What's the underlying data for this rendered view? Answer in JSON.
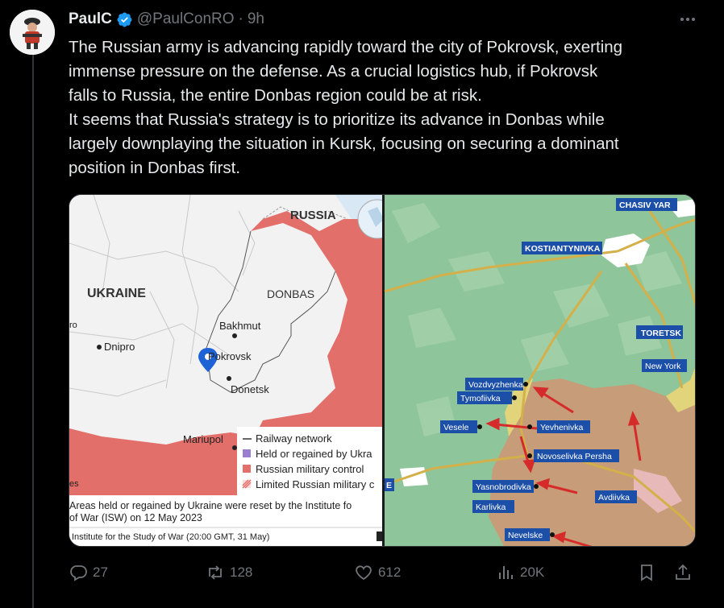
{
  "post": {
    "author_name": "PaulC",
    "handle": "@PaulConRO",
    "separator": "·",
    "time": "9h",
    "text_lines": [
      "The Russian army is advancing rapidly toward the city of Pokrovsk, exerting",
      "immense pressure on the defense. As a crucial logistics hub, if Pokrovsk",
      "falls to Russia, the entire Donbas region could be at risk.",
      "It seems that Russia's strategy is to prioritize its advance in Donbas while",
      "largely downplaying the situation in Kursk, focusing on securing a dominant",
      "position in Donbas first."
    ]
  },
  "map_left": {
    "labels": {
      "russia": "RUSSIA",
      "ukraine": "UKRAINE",
      "donbas": "DONBAS",
      "bakhmut": "Bakhmut",
      "pokrovsk": "Pokrovsk",
      "donetsk": "Donetsk",
      "dnipro": "Dnipro",
      "mariupol": "Mariupol",
      "ro_fragment": "ro",
      "es_fragment": "es"
    },
    "legend": {
      "railway": "Railway network",
      "held": "Held or regained by Ukra",
      "russian": "Russian military control",
      "limited": "Limited Russian military c"
    },
    "note_line1": "Areas held or regained by Ukraine were reset by the Institute fo",
    "note_line2": "of War (ISW) on 12 May 2023",
    "source": "Institute for the Study of War (20:00 GMT, 31 May)",
    "colors": {
      "russian": "#e36f6a",
      "ukraine_held": "#9a7fd1",
      "land": "#f2f2f2",
      "water": "#d8e9f5"
    }
  },
  "map_right": {
    "labels": {
      "chasiv_yar": "CHASIV YAR",
      "kostiantynivka": "KOSTIANTYNIVKA",
      "toretsk": "TORETSK",
      "new_york": "New York",
      "vozdvyzhenka": "Vozdvyzhenka",
      "tymofiivka": "Tymofiivka",
      "vesele": "Vesele",
      "yevhenivka": "Yevhenivka",
      "novoselivka": "Novoselivka Persha",
      "yasnobrodivka": "Yasnobrodivka",
      "avdiivka": "Avdiivka",
      "karlivka": "Karlivka",
      "nevelske": "Nevelske",
      "edge_fragment": "E"
    },
    "colors": {
      "terrain": "#8fc59a",
      "occupied": "#c79c78",
      "road": "#d4b04a",
      "label_bg": "#1c4fa8"
    }
  },
  "actions": {
    "reply": "27",
    "repost": "128",
    "like": "612",
    "views": "20K"
  },
  "icons": [
    "verified-badge-icon",
    "more-icon",
    "reply-icon",
    "repost-icon",
    "like-icon",
    "views-icon",
    "bookmark-icon",
    "share-icon"
  ]
}
